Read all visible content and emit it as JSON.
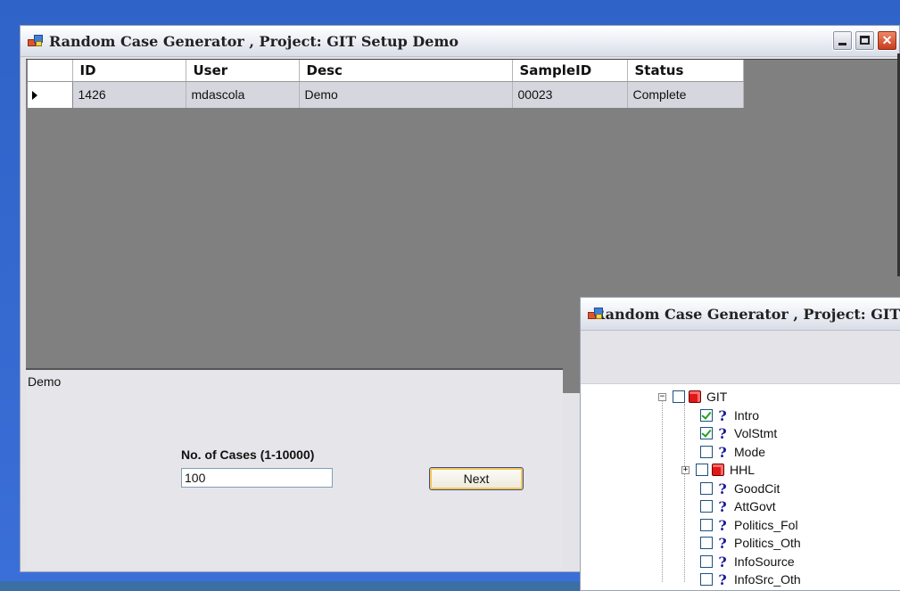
{
  "main_window": {
    "title": "Random Case Generator , Project: GIT Setup Demo",
    "grid": {
      "columns": [
        "ID",
        "User",
        "Desc",
        "SampleID",
        "Status"
      ],
      "rows": [
        {
          "id": "1426",
          "user": "mdascola",
          "desc": "Demo",
          "sample_id": "00023",
          "status": "Complete"
        }
      ]
    },
    "description": "Demo",
    "cases_label": "No. of Cases (1-10000)",
    "cases_value": "100",
    "next_label": "Next"
  },
  "tree_window": {
    "title": "Random Case Generator , Project: GIT Se",
    "nodes": [
      {
        "label": "GIT",
        "checked": false,
        "icon": "cube-icon"
      },
      {
        "label": "Intro",
        "checked": true,
        "icon": "question-icon"
      },
      {
        "label": "VolStmt",
        "checked": true,
        "icon": "question-icon"
      },
      {
        "label": "Mode",
        "checked": false,
        "icon": "question-icon"
      },
      {
        "label": "HHL",
        "checked": false,
        "icon": "cube-icon"
      },
      {
        "label": "GoodCit",
        "checked": false,
        "icon": "question-icon"
      },
      {
        "label": "AttGovt",
        "checked": false,
        "icon": "question-icon"
      },
      {
        "label": "Politics_Fol",
        "checked": false,
        "icon": "question-icon"
      },
      {
        "label": "Politics_Oth",
        "checked": false,
        "icon": "question-icon"
      },
      {
        "label": "InfoSource",
        "checked": false,
        "icon": "question-icon"
      },
      {
        "label": "InfoSrc_Oth",
        "checked": false,
        "icon": "question-icon"
      }
    ]
  }
}
